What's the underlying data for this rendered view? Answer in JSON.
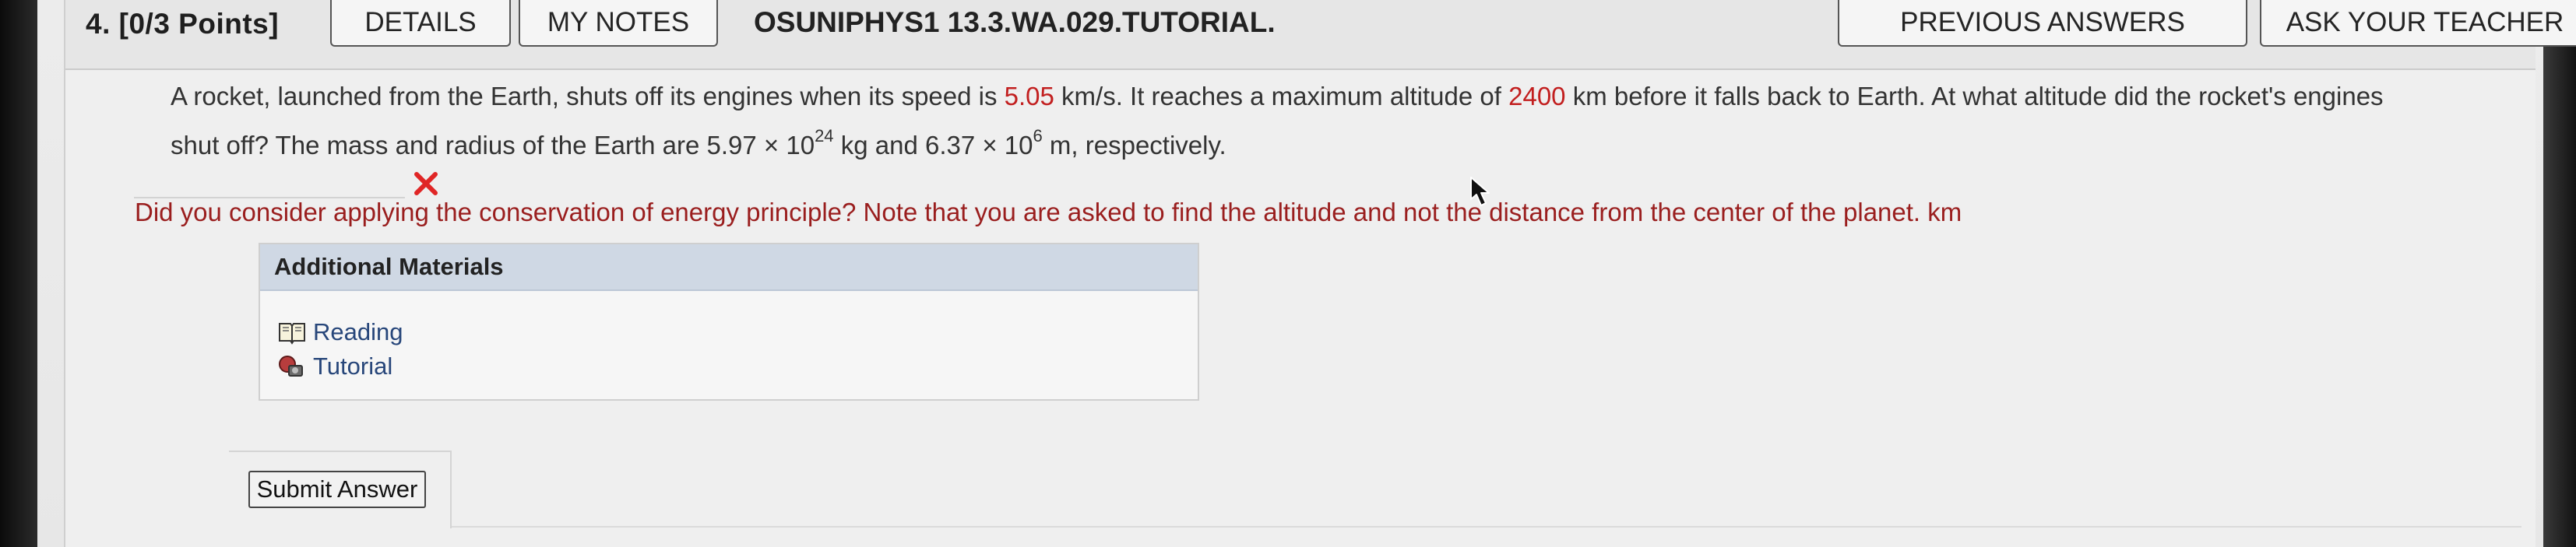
{
  "header": {
    "points": "4.  [0/3 Points]",
    "details_label": "DETAILS",
    "notes_label": "MY NOTES",
    "problem_id": "OSUNIPHYS1 13.3.WA.029.TUTORIAL.",
    "previous_answers_label": "PREVIOUS ANSWERS",
    "ask_teacher_label": "ASK YOUR TEACHER"
  },
  "question": {
    "line1_a": "A rocket, launched from the Earth, shuts off its engines when its speed is ",
    "speed": "5.05",
    "line1_b": " km/s. It reaches a maximum altitude of ",
    "altitude": "2400",
    "line1_c": " km before it falls back to Earth. At what altitude did the rocket's engines",
    "line2_a": "shut off? The mass and radius of the Earth are 5.97 × 10",
    "mass_exponent": "24",
    "line2_b": " kg and 6.37 × 10",
    "radius_exponent": "6",
    "line2_c": " m, respectively."
  },
  "answer": {
    "value": "",
    "status_icon": "red-x-icon"
  },
  "feedback": {
    "text": "Did you consider applying the conservation of energy principle? Note that you are asked to find the altitude and not the distance from the center of the planet. km"
  },
  "materials": {
    "title": "Additional Materials",
    "items": [
      {
        "label": "Reading",
        "icon": "book-icon"
      },
      {
        "label": "Tutorial",
        "icon": "tutorial-icon"
      }
    ]
  },
  "actions": {
    "submit_label": "Submit Answer"
  },
  "colors": {
    "value_red": "#c21f1f",
    "feedback_red": "#9a1e1e",
    "materials_header": "#cfd8e4",
    "link_blue": "#27467a"
  }
}
